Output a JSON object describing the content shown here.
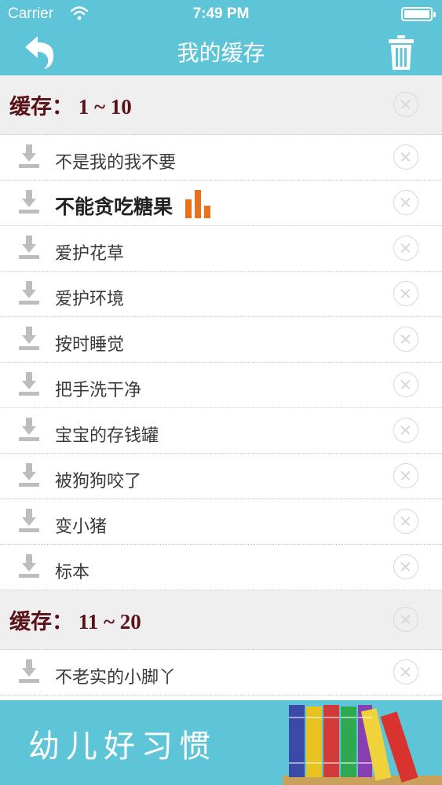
{
  "status_bar": {
    "carrier": "Carrier",
    "time": "7:49 PM"
  },
  "nav": {
    "title": "我的缓存",
    "back_icon": "back-arrow-icon",
    "trash_icon": "trash-icon"
  },
  "sections": [
    {
      "label": "缓存：  1 ~ 10",
      "items": [
        {
          "label": "不是我的我不要",
          "active": false
        },
        {
          "label": "不能贪吃糖果",
          "active": true
        },
        {
          "label": "爱护花草",
          "active": false
        },
        {
          "label": "爱护环境",
          "active": false
        },
        {
          "label": "按时睡觉",
          "active": false
        },
        {
          "label": "把手洗干净",
          "active": false
        },
        {
          "label": "宝宝的存钱罐",
          "active": false
        },
        {
          "label": "被狗狗咬了",
          "active": false
        },
        {
          "label": "变小猪",
          "active": false
        },
        {
          "label": "标本",
          "active": false
        }
      ]
    },
    {
      "label": "缓存：  11 ~ 20",
      "items": [
        {
          "label": "不老实的小脚丫",
          "active": false
        }
      ]
    }
  ],
  "banner": {
    "text": "幼儿好习惯"
  },
  "colors": {
    "accent": "#5ec4d7",
    "section_text": "#5a1218",
    "playing": "#e7721b"
  }
}
